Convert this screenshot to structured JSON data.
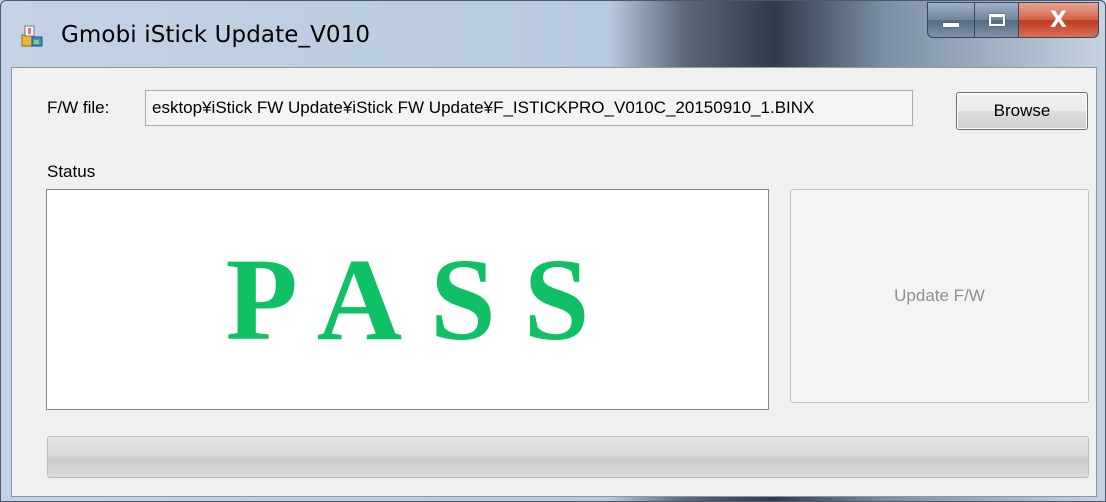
{
  "window": {
    "title": "Gmobi iStick Update_V010",
    "app_icon": "installer-icon",
    "controls": {
      "minimize_icon": "minimize-icon",
      "maximize_icon": "maximize-icon",
      "close_icon": "close-icon",
      "close_glyph": "X"
    }
  },
  "firmware": {
    "label": "F/W file:",
    "path": "esktop¥iStick FW Update¥iStick FW Update¥F_ISTICKPRO_V010C_20150910_1.BINX",
    "browse_label": "Browse"
  },
  "status": {
    "label": "Status",
    "result": "PASS",
    "result_color": "#0fc064"
  },
  "update_button": {
    "label": "Update F/W",
    "enabled": false
  },
  "progress": {
    "value": 0
  }
}
